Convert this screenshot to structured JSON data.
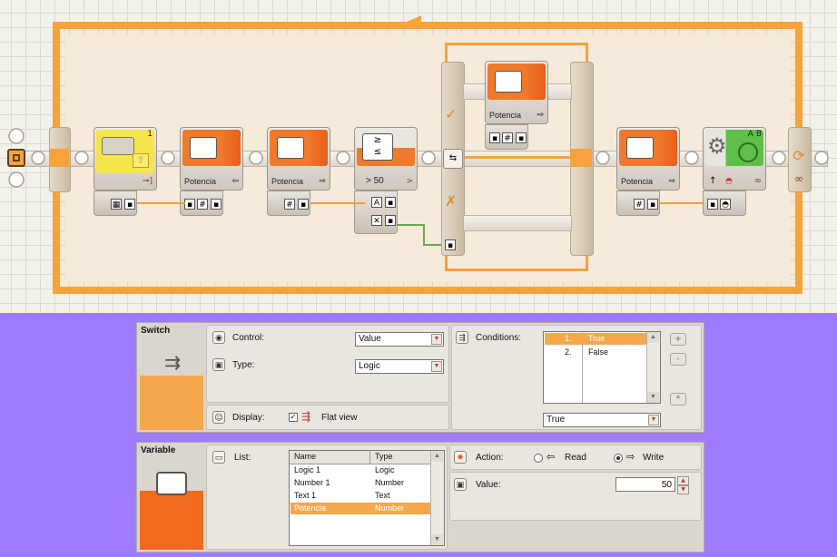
{
  "canvas": {
    "blocks": [
      {
        "name": "touch-sensor-block",
        "port_label": "1"
      },
      {
        "name": "variable-read-block-1",
        "label": "Potencia"
      },
      {
        "name": "variable-write-block-1",
        "label": "Potencia"
      },
      {
        "name": "compare-block",
        "label": "> 50"
      },
      {
        "name": "switch-true-variable-block",
        "label": "Potencia"
      },
      {
        "name": "variable-block-3",
        "label": "Potencia"
      },
      {
        "name": "motor-block",
        "ports_label": "A B"
      }
    ]
  },
  "switch_panel": {
    "title": "Switch",
    "control_label": "Control:",
    "control_value": "Value",
    "type_label": "Type:",
    "type_value": "Logic",
    "display_label": "Display:",
    "flat_view_label": "Flat view",
    "conditions_label": "Conditions:",
    "conditions": [
      {
        "num": "1.",
        "value": "True"
      },
      {
        "num": "2.",
        "value": "False"
      }
    ],
    "selected_condition": "True",
    "add_btn": "+",
    "remove_btn": "-",
    "default_btn": "*"
  },
  "variable_panel": {
    "title": "Variable",
    "list_label": "List:",
    "columns": {
      "name": "Name",
      "type": "Type"
    },
    "rows": [
      {
        "name": "Logic 1",
        "type": "Logic"
      },
      {
        "name": "Number 1",
        "type": "Number"
      },
      {
        "name": "Text 1",
        "type": "Text"
      },
      {
        "name": "Potencia",
        "type": "Number"
      }
    ],
    "action_label": "Action:",
    "read_label": "Read",
    "write_label": "Write",
    "value_label": "Value:",
    "value": "50"
  },
  "colors": {
    "accent_orange": "#F7A23A",
    "panel_bg": "#9E7BFF",
    "logic_green": "#6AA84F",
    "selection": "#F5A74C"
  }
}
